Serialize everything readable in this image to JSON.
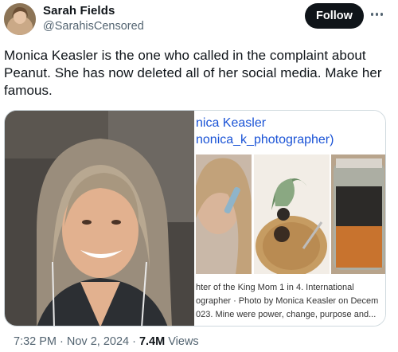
{
  "author": {
    "display_name": "Sarah Fields",
    "handle": "@SarahisCensored",
    "avatar_icon": "avatar-photo"
  },
  "actions": {
    "follow_label": "Follow",
    "more_icon": "more-dots-icon"
  },
  "tweet": {
    "text": "Monica Keasler is the one who called in the complaint about Peanut. She has now deleted all of her social media. Make her famous."
  },
  "media": {
    "right_panel": {
      "name_fragment": "nica Keasler",
      "handle_fragment": "nonica_k_photographer)",
      "caption_lines": [
        "hter of the King Mom 1 in 4. International",
        "ographer · Photo by Monica Keasler on Decem",
        "023. Mine were power, change, purpose and..."
      ]
    }
  },
  "meta": {
    "time": "7:32 PM · Nov 2, 2024 · ",
    "views_count": "7.4M",
    "views_label": " Views"
  },
  "colors": {
    "text": "#0f1419",
    "secondary": "#536471",
    "link_blue": "#1a53d6",
    "border": "#cfd9de"
  }
}
